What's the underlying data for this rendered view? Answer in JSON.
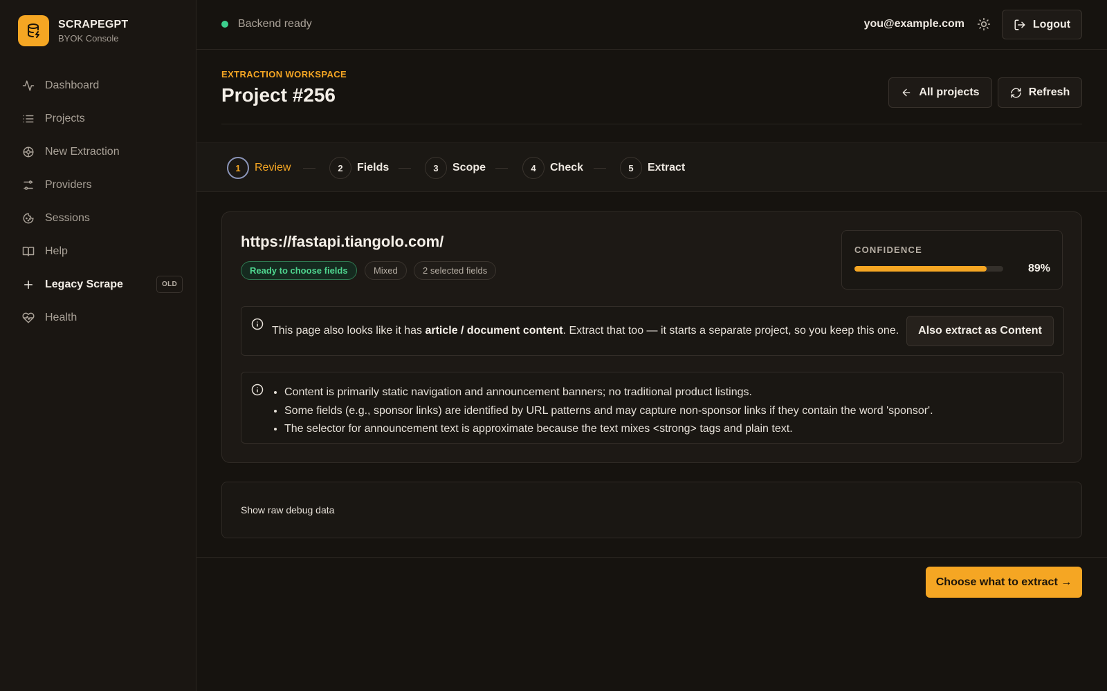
{
  "brand": {
    "name": "SCRAPEGPT",
    "subtitle": "BYOK Console",
    "accent": "#f5a623"
  },
  "sidebar": {
    "items": [
      {
        "label": "Dashboard",
        "icon": "activity-icon"
      },
      {
        "label": "Projects",
        "icon": "list-icon"
      },
      {
        "label": "New Extraction",
        "icon": "aperture-icon"
      },
      {
        "label": "Providers",
        "icon": "sliders-icon"
      },
      {
        "label": "Sessions",
        "icon": "cookie-icon"
      },
      {
        "label": "Help",
        "icon": "book-icon"
      },
      {
        "label": "Legacy Scrape",
        "icon": "plus-icon",
        "badge": "OLD",
        "active": true
      },
      {
        "label": "Health",
        "icon": "heart-pulse-icon"
      }
    ]
  },
  "topbar": {
    "status": "Backend ready",
    "status_color": "#3ccf8e",
    "user_email": "you@example.com",
    "logout_label": "Logout"
  },
  "header": {
    "eyebrow": "EXTRACTION WORKSPACE",
    "title": "Project #256",
    "all_projects_label": "All projects",
    "refresh_label": "Refresh"
  },
  "stepper": {
    "steps": [
      {
        "num": "1",
        "label": "Review",
        "active": true
      },
      {
        "num": "2",
        "label": "Fields"
      },
      {
        "num": "3",
        "label": "Scope"
      },
      {
        "num": "4",
        "label": "Check"
      },
      {
        "num": "5",
        "label": "Extract"
      }
    ]
  },
  "review": {
    "url": "https://fastapi.tiangolo.com/",
    "chips": [
      "Ready to choose fields",
      "Mixed",
      "2 selected fields"
    ],
    "confidence_label": "CONFIDENCE",
    "confidence_value": "89%",
    "confidence_fraction": 0.89,
    "notice": {
      "prefix": "This page also looks like it has ",
      "bold": "article / document content",
      "suffix": ". Extract that too — it starts a separate project, so you keep this one.",
      "button": "Also extract as Content"
    },
    "notes": [
      "Content is primarily static navigation and announcement banners; no traditional product listings.",
      "Some fields (e.g., sponsor links) are identified by URL patterns and may capture non-sponsor links if they contain the word 'sponsor'.",
      "The selector for announcement text is approximate because the text mixes <strong> tags and plain text."
    ]
  },
  "debug": {
    "label": "Show raw debug data"
  },
  "cta": {
    "label": "Choose what to extract →"
  }
}
